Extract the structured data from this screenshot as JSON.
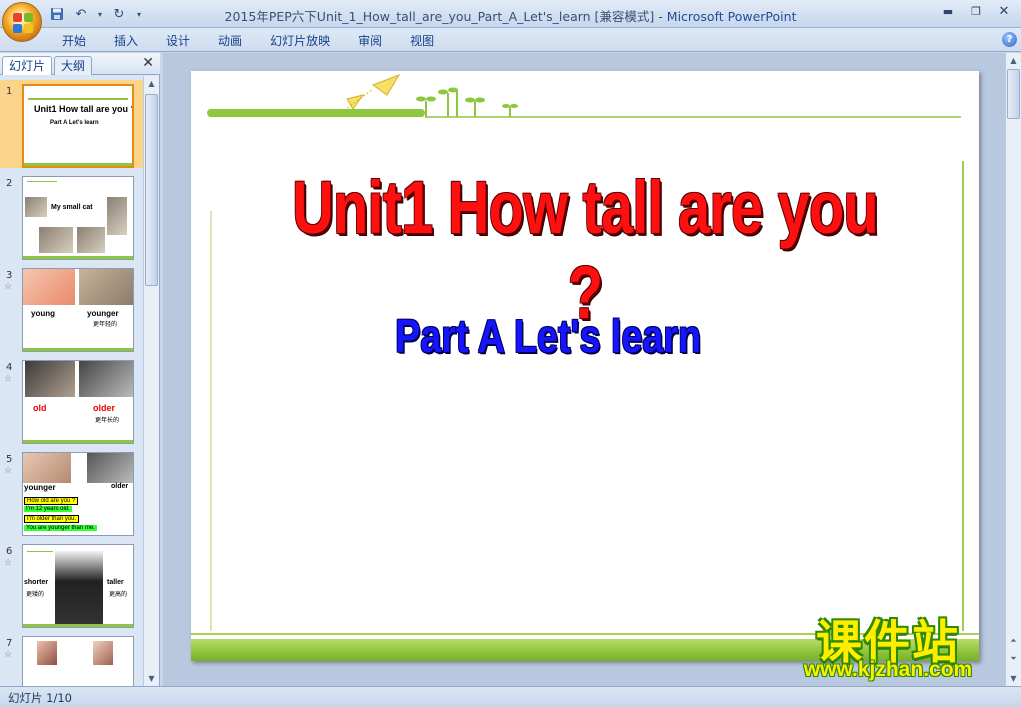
{
  "window": {
    "title_doc": "2015年PEP六下Unit_1_How_tall_are_you_Part_A_Let's_learn [兼容模式] - ",
    "title_app": "Microsoft PowerPoint"
  },
  "ribbon": {
    "tabs": [
      "开始",
      "插入",
      "设计",
      "动画",
      "幻灯片放映",
      "审阅",
      "视图"
    ]
  },
  "panel": {
    "tab_slides": "幻灯片",
    "tab_outline": "大纲",
    "close": "✕"
  },
  "thumbnails": [
    {
      "num": "1",
      "star": "",
      "title": "Unit1 How tall are you ?",
      "sub": "Part A Let's learn"
    },
    {
      "num": "2",
      "star": "☆",
      "text": "My small  cat"
    },
    {
      "num": "3",
      "star": "☆",
      "word1": "young",
      "word2": "younger",
      "cap2": "更年轻的"
    },
    {
      "num": "4",
      "star": "☆",
      "word1": "old",
      "word2": "older",
      "cap2": "更年长的"
    },
    {
      "num": "5",
      "star": "☆",
      "word1": "younger",
      "word2": "older",
      "lines": [
        "How old are you ?",
        "I'm 12 years old.",
        "I'm older than you.",
        "You are younger than me."
      ]
    },
    {
      "num": "6",
      "star": "☆",
      "word1": "shorter",
      "cap1": "更矮的",
      "word2": "taller",
      "cap2": "更高的"
    },
    {
      "num": "7",
      "star": "☆"
    }
  ],
  "slide": {
    "title": "Unit1 How tall are you ?",
    "subtitle": "Part A Let's learn"
  },
  "status": {
    "slide_info": "幻灯片 1/10"
  },
  "watermark": {
    "cn": "课件站",
    "url": "www.kjzhan.com"
  },
  "colors": {
    "title_red": "#ff1010",
    "subtitle_blue": "#1515ff",
    "slide_green": "#8dc63f",
    "selected_thumb": "#fbd48a"
  }
}
